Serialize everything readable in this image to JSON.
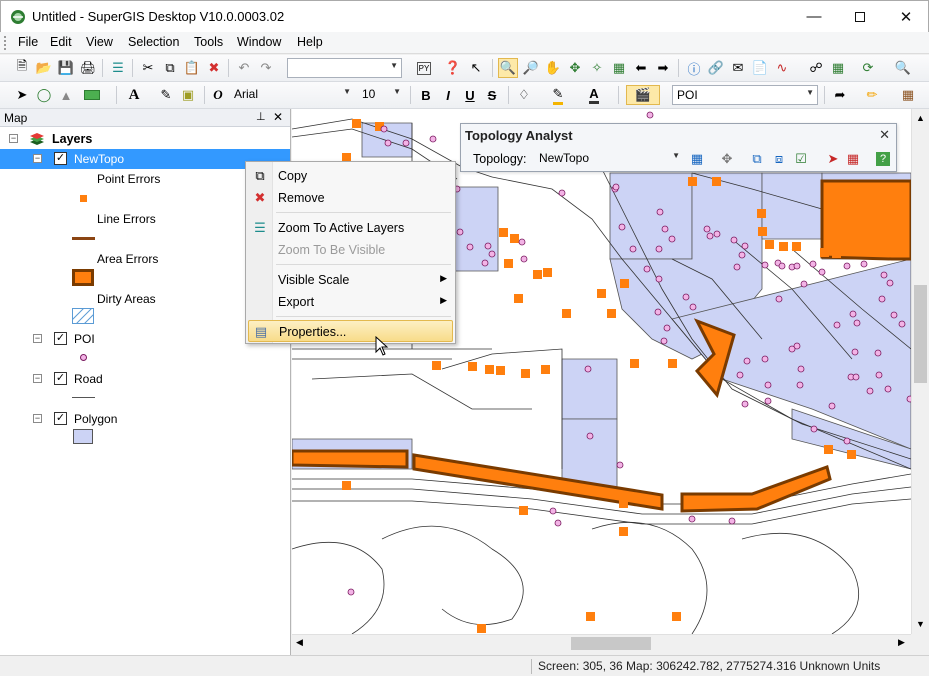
{
  "window": {
    "title": "Untitled - SuperGIS Desktop V10.0.0003.02",
    "minimize_icon": "minimize-icon",
    "maximize_icon": "maximize-icon",
    "close_icon": "close-icon"
  },
  "menu": [
    "File",
    "Edit",
    "View",
    "Selection",
    "Tools",
    "Window",
    "Help"
  ],
  "toolbar_font": {
    "font_name": "Arial",
    "font_size": "10",
    "bold": "B",
    "italic": "I",
    "underline": "U",
    "strike": "S",
    "layer_select": "POI"
  },
  "map_panel": {
    "title": "Map",
    "pin_icon": "pin-icon",
    "close_icon": "close-icon",
    "root": "Layers",
    "layers": [
      {
        "name": "NewTopo",
        "checked": true,
        "selected": true
      },
      {
        "name": "POI",
        "checked": true
      },
      {
        "name": "Road",
        "checked": true
      },
      {
        "name": "Polygon",
        "checked": true
      }
    ],
    "legend": {
      "point_errors": "Point Errors",
      "line_errors": "Line Errors",
      "area_errors": "Area Errors",
      "dirty_areas": "Dirty Areas"
    }
  },
  "context_menu": {
    "copy": "Copy",
    "remove": "Remove",
    "zoom_active": "Zoom To Active Layers",
    "zoom_visible": "Zoom To Be Visible",
    "visible_scale": "Visible Scale",
    "export": "Export",
    "properties": "Properties..."
  },
  "topology_analyst": {
    "title": "Topology Analyst",
    "label": "Topology:",
    "value": "NewTopo"
  },
  "status": {
    "text": "Screen: 305, 36  Map: 306242.782, 2775274.316 Unknown Units"
  },
  "colors": {
    "error_orange": "#ff7f0e",
    "polygon_fill": "#ccd3f5",
    "selection": "#3399ff"
  }
}
